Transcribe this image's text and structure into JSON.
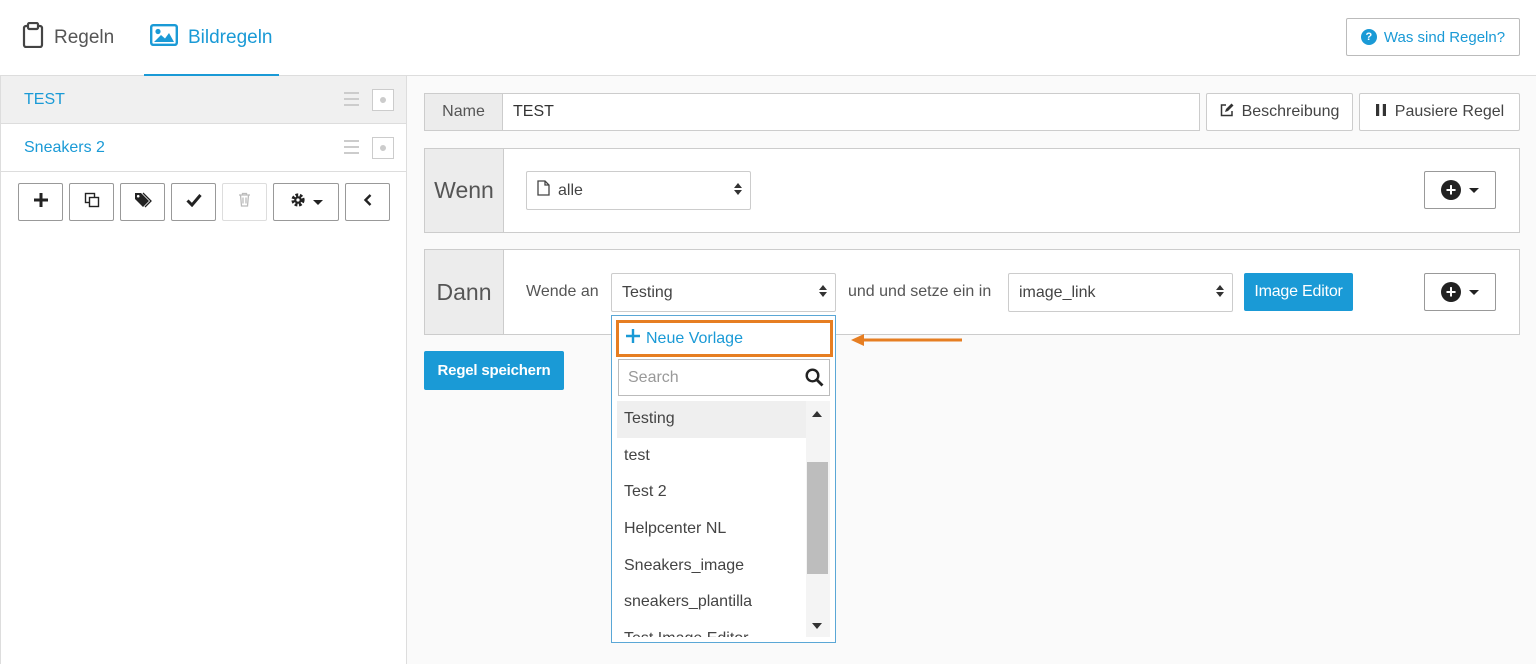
{
  "tabs": [
    {
      "label": "Regeln",
      "icon": "clipboard-icon"
    },
    {
      "label": "Bildregeln",
      "icon": "image-icon",
      "active": true
    }
  ],
  "help_button": {
    "label": "Was sind Regeln?",
    "icon": "question-circle-icon"
  },
  "sidebar": {
    "rules": [
      {
        "name": "TEST",
        "active": true
      },
      {
        "name": "Sneakers 2",
        "active": false
      }
    ],
    "toolbar": [
      "plus-icon",
      "copy-icon",
      "tags-icon",
      "check-icon",
      "trash-icon",
      "gear-icon",
      "chevron-left-icon"
    ]
  },
  "editor": {
    "name_label": "Name",
    "name_value": "TEST",
    "description_button": "Beschreibung",
    "pause_button": "Pausiere Regel",
    "wenn": {
      "label": "Wenn",
      "select_value": "alle"
    },
    "dann": {
      "label": "Dann",
      "apply_label": "Wende an",
      "template_value": "Testing",
      "insert_label": "und und setze ein in",
      "field_value": "image_link",
      "image_editor_button": "Image Editor"
    },
    "save_button": "Regel speichern"
  },
  "dropdown": {
    "new_template": "Neue Vorlage",
    "search_placeholder": "Search",
    "options": [
      "Testing",
      "test",
      "Test 2",
      "Helpcenter NL",
      "Sneakers_image",
      "sneakers_plantilla",
      "Test Image Editor"
    ],
    "selected": "Testing"
  },
  "colors": {
    "accent": "#1a9ad6",
    "highlight": "#e67e22"
  }
}
